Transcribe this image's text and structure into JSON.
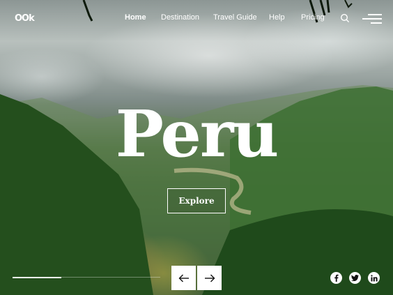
{
  "brand": {
    "logo_text": "OOk"
  },
  "nav": {
    "items": [
      {
        "label": "Home",
        "active": true
      },
      {
        "label": "Destination",
        "active": false
      },
      {
        "label": "Travel Guide",
        "active": false
      },
      {
        "label": "Help",
        "active": false
      },
      {
        "label": "Pricing",
        "active": false
      }
    ],
    "search_icon": "search-icon",
    "menu_icon": "hamburger-menu-icon"
  },
  "hero": {
    "title": "Peru",
    "cta_label": "Explore"
  },
  "slider": {
    "progress_percent": 33,
    "prev_icon": "arrow-left-icon",
    "next_icon": "arrow-right-icon"
  },
  "social": [
    {
      "name": "facebook",
      "glyph": "f"
    },
    {
      "name": "twitter",
      "glyph": "t"
    },
    {
      "name": "linkedin",
      "glyph": "in"
    }
  ],
  "colors": {
    "text": "#ffffff",
    "button_bg": "#ffffff",
    "icon_dark": "#111111"
  }
}
